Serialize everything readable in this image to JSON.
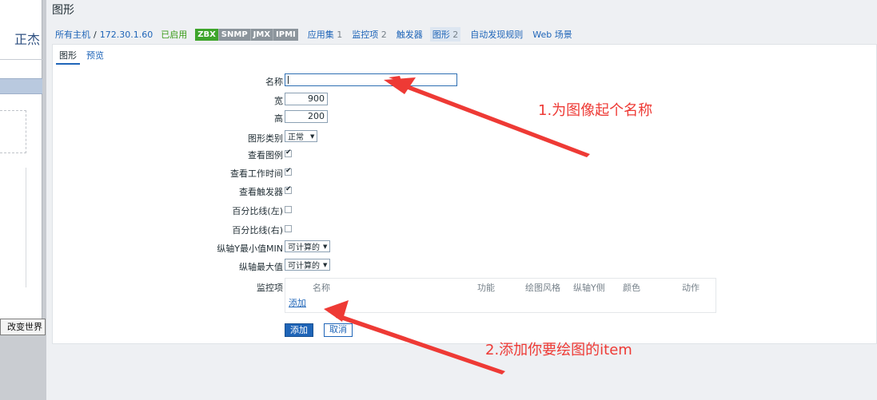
{
  "left_window": {
    "title_fragment": "正杰",
    "button_label": "改变世界"
  },
  "page": {
    "title": "图形"
  },
  "breadcrumb": {
    "all_hosts": "所有主机",
    "separator": "/",
    "host": "172.30.1.60",
    "status": "已启用",
    "badges": [
      "ZBX",
      "SNMP",
      "JMX",
      "IPMI"
    ],
    "links": [
      {
        "label": "应用集",
        "count": "1"
      },
      {
        "label": "监控项",
        "count": "2"
      },
      {
        "label": "触发器",
        "count": ""
      },
      {
        "label": "图形",
        "count": "2"
      },
      {
        "label": "自动发现规则",
        "count": ""
      },
      {
        "label": "Web 场景",
        "count": ""
      }
    ]
  },
  "tabs": [
    "图形",
    "预览"
  ],
  "form": {
    "name_label": "名称",
    "name_value": "",
    "width_label": "宽",
    "width_value": "900",
    "height_label": "高",
    "height_value": "200",
    "graph_type_label": "图形类别",
    "graph_type_value": "正常",
    "show_legend_label": "查看图例",
    "show_legend": true,
    "show_working_time_label": "查看工作时间",
    "show_working_time": true,
    "show_triggers_label": "查看触发器",
    "show_triggers": true,
    "percentile_left_label": "百分比线(左)",
    "percentile_left": false,
    "percentile_right_label": "百分比线(右)",
    "percentile_right": false,
    "ymin_label": "纵轴Y最小值MIN",
    "ymin_value": "可计算的",
    "ymax_label": "纵轴最大值",
    "ymax_value": "可计算的",
    "items_label": "监控项",
    "items_columns": [
      "名称",
      "功能",
      "绘图风格",
      "纵轴Y侧",
      "颜色",
      "动作"
    ],
    "items_add_link": "添加"
  },
  "buttons": {
    "add": "添加",
    "cancel": "取消"
  },
  "annotations": {
    "note1": "1.为图像起个名称",
    "note2": "2.添加你要绘图的item",
    "color": "#ee3a35"
  },
  "colors": {
    "accent": "#1f65b8",
    "zbx_badge": "#3ea52b",
    "disabled_badge": "#8c959c",
    "enabled_text": "#3b9c1a"
  }
}
